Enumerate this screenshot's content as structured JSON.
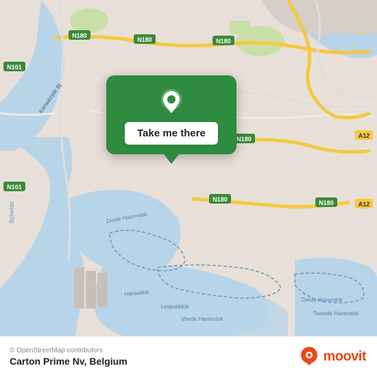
{
  "map": {
    "alt": "Map of Antwerp harbor area, Belgium"
  },
  "popup": {
    "button_label": "Take me there"
  },
  "footer": {
    "copyright": "© OpenStreetMap contributors",
    "location": "Carton Prime Nv, Belgium"
  },
  "moovit": {
    "text": "moovit"
  }
}
